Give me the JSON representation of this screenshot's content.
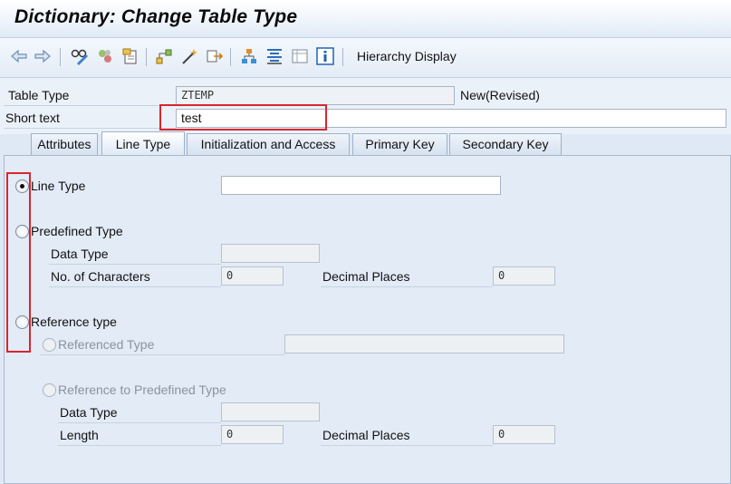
{
  "window": {
    "title": "Dictionary: Change Table Type"
  },
  "toolbar": {
    "icons": [
      "back-arrow-icon",
      "forward-arrow-icon",
      "glasses-pencil-icon",
      "activate-icon",
      "other-object-icon",
      "where-used-icon",
      "magic-wand-icon",
      "navigate-icon",
      "hierarchy-icon",
      "align-icon",
      "display-list-icon",
      "info-icon"
    ],
    "hierarchy_display": "Hierarchy Display"
  },
  "header": {
    "table_type_label": "Table Type",
    "table_type_value": "ZTEMP",
    "status": "New(Revised)",
    "short_text_label": "Short text",
    "short_text_value": "test"
  },
  "tabs": [
    {
      "label": "Attributes"
    },
    {
      "label": "Line Type"
    },
    {
      "label": "Initialization and Access"
    },
    {
      "label": "Primary Key"
    },
    {
      "label": "Secondary Key"
    }
  ],
  "line_type_tab": {
    "line_type_label": "Line Type",
    "line_type_value": "",
    "predefined_type_label": "Predefined Type",
    "data_type_label": "Data Type",
    "data_type_value": "",
    "no_of_chars_label": "No. of Characters",
    "no_of_chars_value": "0",
    "decimal_places_label": "Decimal Places",
    "decimal_places_value": "0",
    "reference_type_label": "Reference type",
    "referenced_type_label": "Referenced Type",
    "referenced_type_value": "",
    "ref_predefined_label": "Reference to Predefined Type",
    "ref_data_type_label": "Data Type",
    "ref_data_type_value": "",
    "length_label": "Length",
    "length_value": "0",
    "ref_decimal_places_label": "Decimal Places",
    "ref_decimal_places_value": "0"
  },
  "colors": {
    "highlight": "#d8262e",
    "background": "#dfe9f5"
  }
}
